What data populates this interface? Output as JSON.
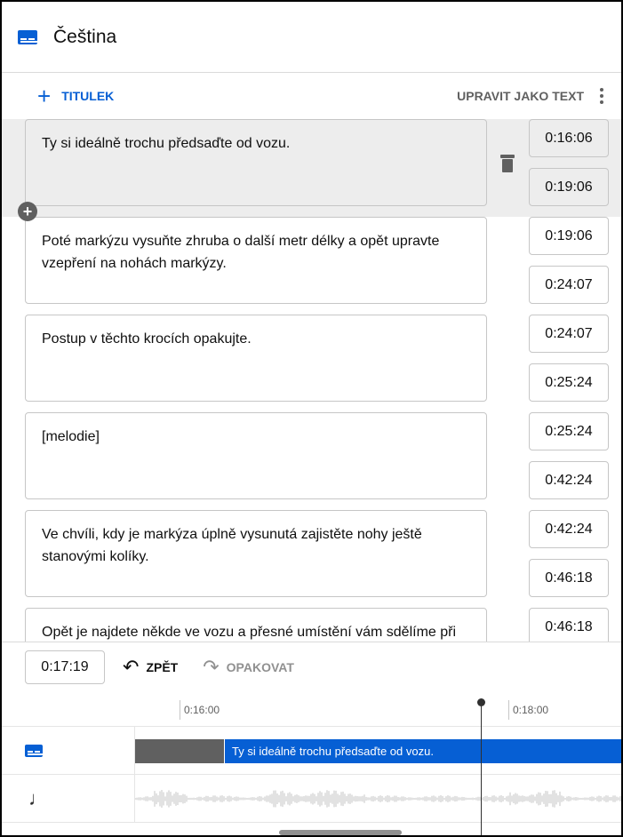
{
  "header": {
    "title": "Čeština",
    "icon": "subtitles-icon"
  },
  "toolbar": {
    "add_label": "TITULEK",
    "edit_as_text_label": "UPRAVIT JAKO TEXT"
  },
  "subtitles": [
    {
      "text": "Ty si ideálně trochu předsaďte od vozu.",
      "start": "0:16:06",
      "end": "0:19:06"
    },
    {
      "text": "Poté markýzu vysuňte zhruba o další metr délky a opět upravte vzepření na nohách markýzy.",
      "start": "0:19:06",
      "end": "0:24:07"
    },
    {
      "text": "Postup v těchto krocích opakujte.",
      "start": "0:24:07",
      "end": "0:25:24"
    },
    {
      "text": "[melodie]",
      "start": "0:25:24",
      "end": "0:42:24"
    },
    {
      "text": "Ve chvíli, kdy je markýza úplně vysunutá zajistěte nohy ještě stanovými kolíky.",
      "start": "0:42:24",
      "end": "0:46:18"
    },
    {
      "text": "Opět je najdete někde ve vozu a přesné umístění vám sdělíme při",
      "start": "0:46:18",
      "end": ""
    }
  ],
  "controls": {
    "current_time": "0:17:19",
    "undo_label": "ZPĚT",
    "redo_label": "OPAKOVAT"
  },
  "timeline": {
    "ticks": [
      "0:16:00",
      "0:18:00"
    ],
    "subtitle_segment_text": "Ty si ideálně trochu předsaďte od vozu."
  },
  "colors": {
    "accent": "#065fd4",
    "selected_row": "#ededed"
  }
}
